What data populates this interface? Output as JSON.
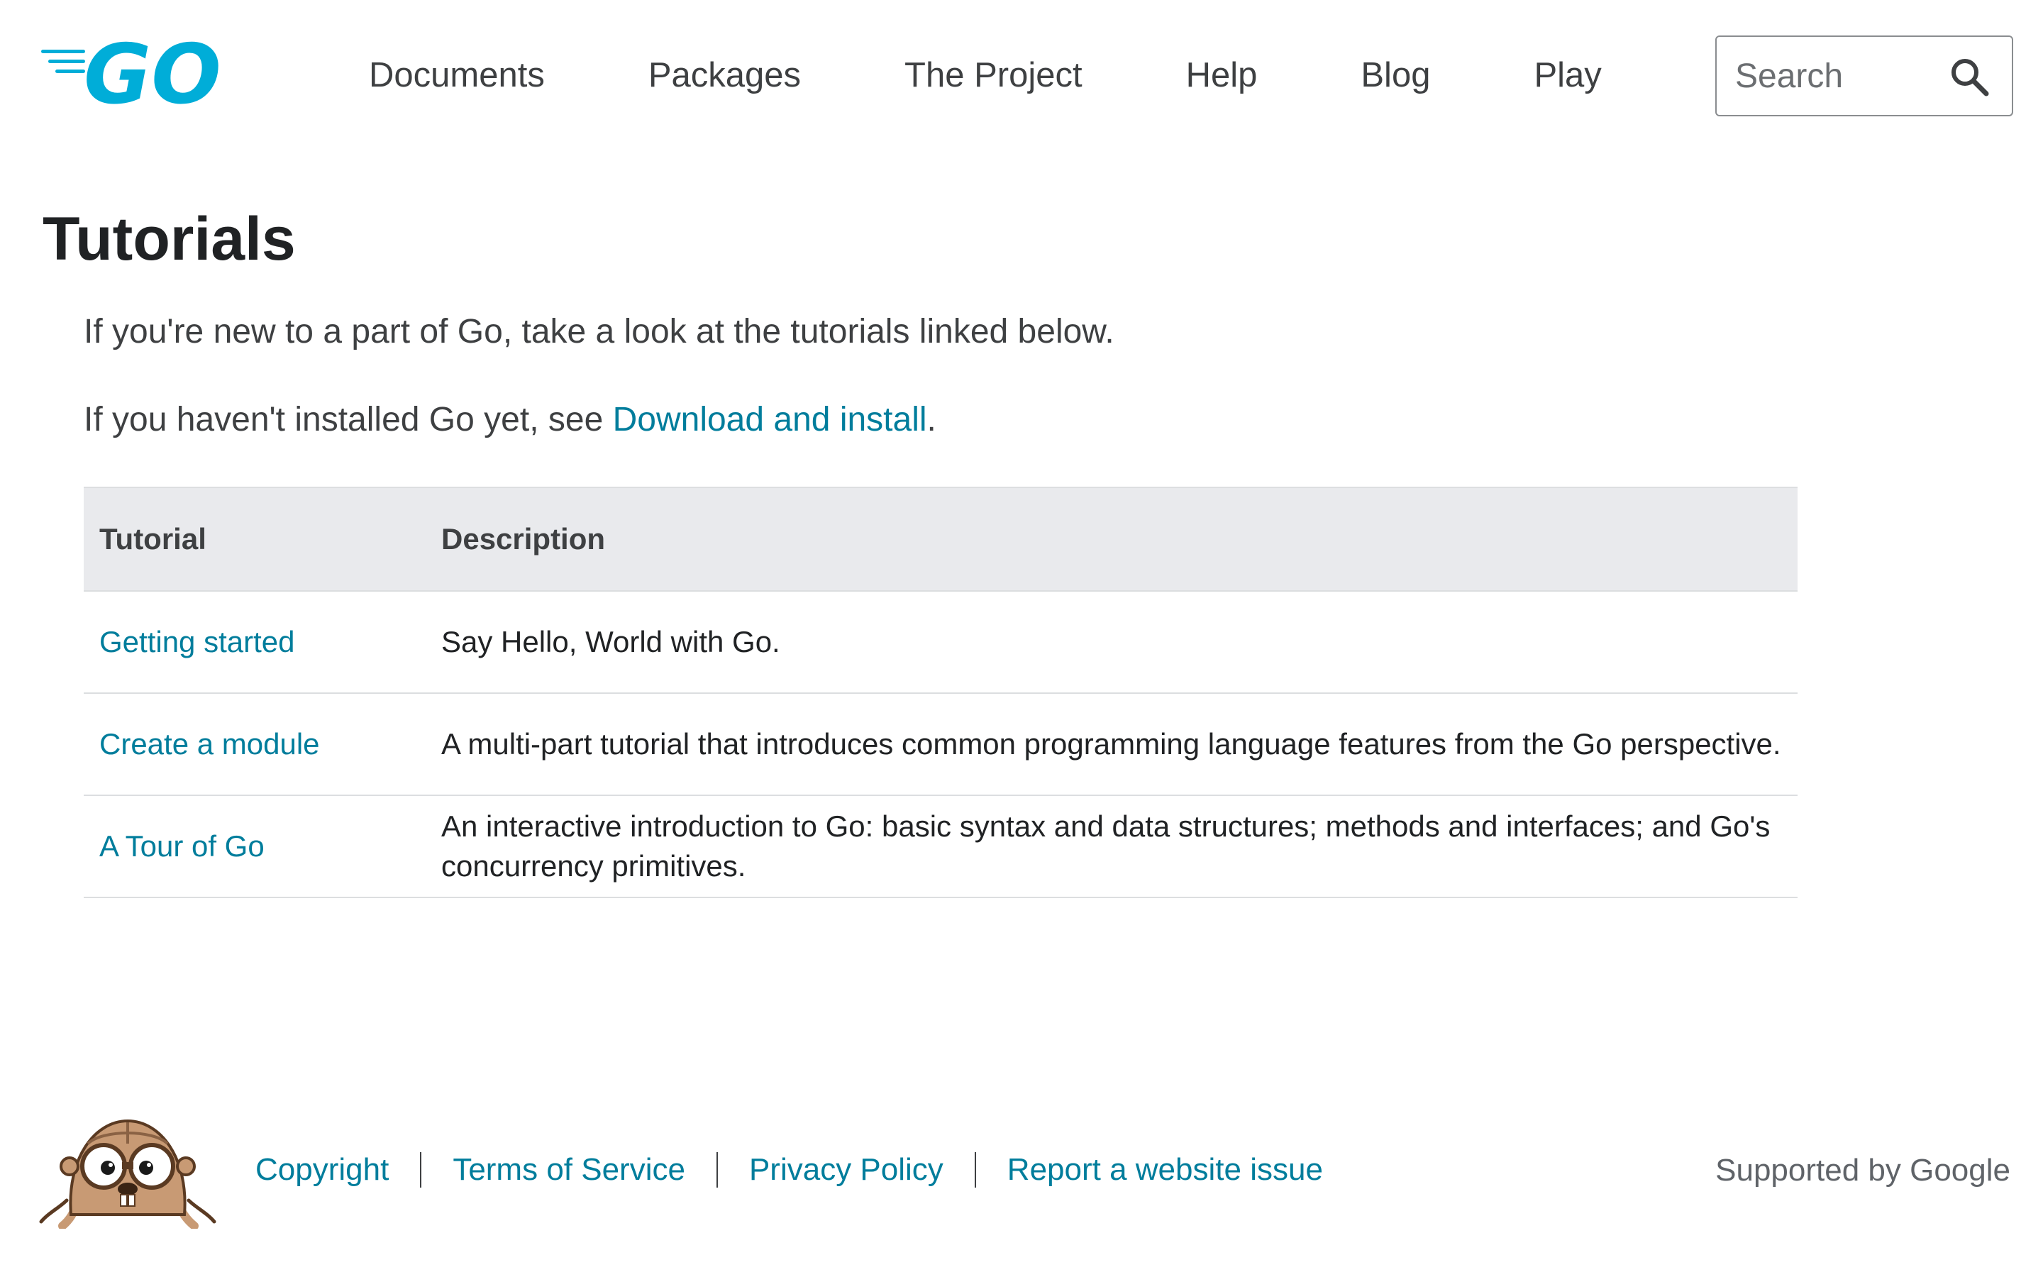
{
  "header": {
    "logo_text": "GO",
    "nav": [
      "Documents",
      "Packages",
      "The Project",
      "Help",
      "Blog",
      "Play"
    ],
    "search_placeholder": "Search"
  },
  "main": {
    "title": "Tutorials",
    "intro": "If you're new to a part of Go, take a look at the tutorials linked below.",
    "install_prefix": "If you haven't installed Go yet, see ",
    "install_link": "Download and install",
    "install_suffix": ".",
    "table": {
      "headers": [
        "Tutorial",
        "Description"
      ],
      "rows": [
        {
          "name": "Getting started",
          "description": "Say Hello, World with Go."
        },
        {
          "name": "Create a module",
          "description": "A multi-part tutorial that introduces common programming language features from the Go perspective."
        },
        {
          "name": "A Tour of Go",
          "description": "An interactive introduction to Go: basic syntax and data structures; methods and interfaces; and Go's concurrency primitives."
        }
      ]
    }
  },
  "footer": {
    "links": [
      "Copyright",
      "Terms of Service",
      "Privacy Policy",
      "Report a website issue"
    ],
    "supported": "Supported by Google"
  },
  "colors": {
    "brand": "#00add8",
    "link": "#007d9c",
    "table_header_bg": "#e9eaed"
  }
}
